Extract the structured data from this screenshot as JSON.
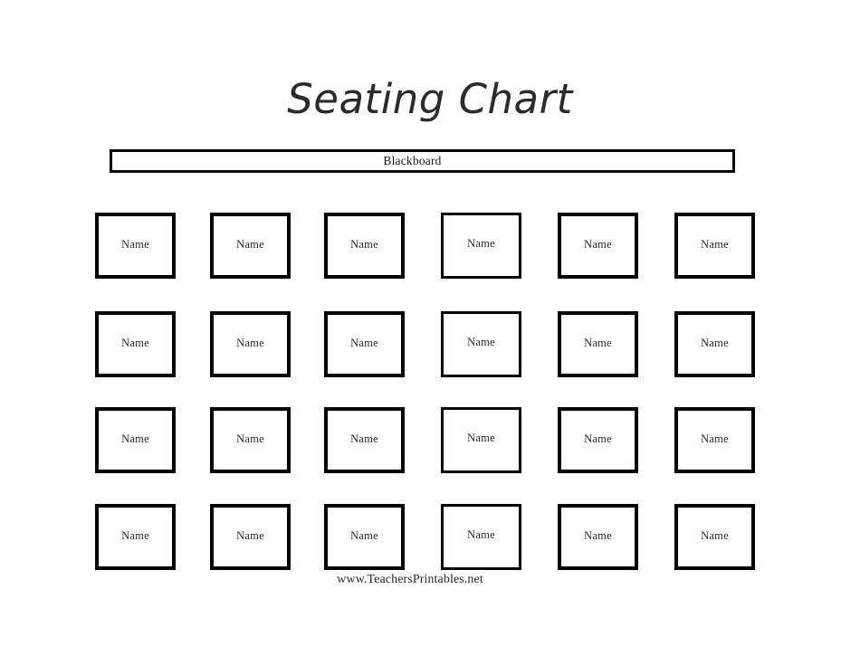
{
  "document": {
    "title": "Seating Chart",
    "page_background": "#ffffff",
    "ink_color": "#000000"
  },
  "blackboard": {
    "label": "Blackboard"
  },
  "grid": {
    "rows": 4,
    "columns": 6,
    "default_seat_label": "Name",
    "seats": [
      [
        {
          "label": "Name"
        },
        {
          "label": "Name"
        },
        {
          "label": "Name"
        },
        {
          "label": "Name"
        },
        {
          "label": "Name"
        },
        {
          "label": "Name"
        }
      ],
      [
        {
          "label": "Name"
        },
        {
          "label": "Name"
        },
        {
          "label": "Name"
        },
        {
          "label": "Name"
        },
        {
          "label": "Name"
        },
        {
          "label": "Name"
        }
      ],
      [
        {
          "label": "Name"
        },
        {
          "label": "Name"
        },
        {
          "label": "Name"
        },
        {
          "label": "Name"
        },
        {
          "label": "Name"
        },
        {
          "label": "Name"
        }
      ],
      [
        {
          "label": "Name"
        },
        {
          "label": "Name"
        },
        {
          "label": "Name"
        },
        {
          "label": "Name"
        },
        {
          "label": "Name"
        },
        {
          "label": "Name"
        }
      ]
    ]
  },
  "footer": {
    "credit": "www.TeachersPrintables.net"
  }
}
